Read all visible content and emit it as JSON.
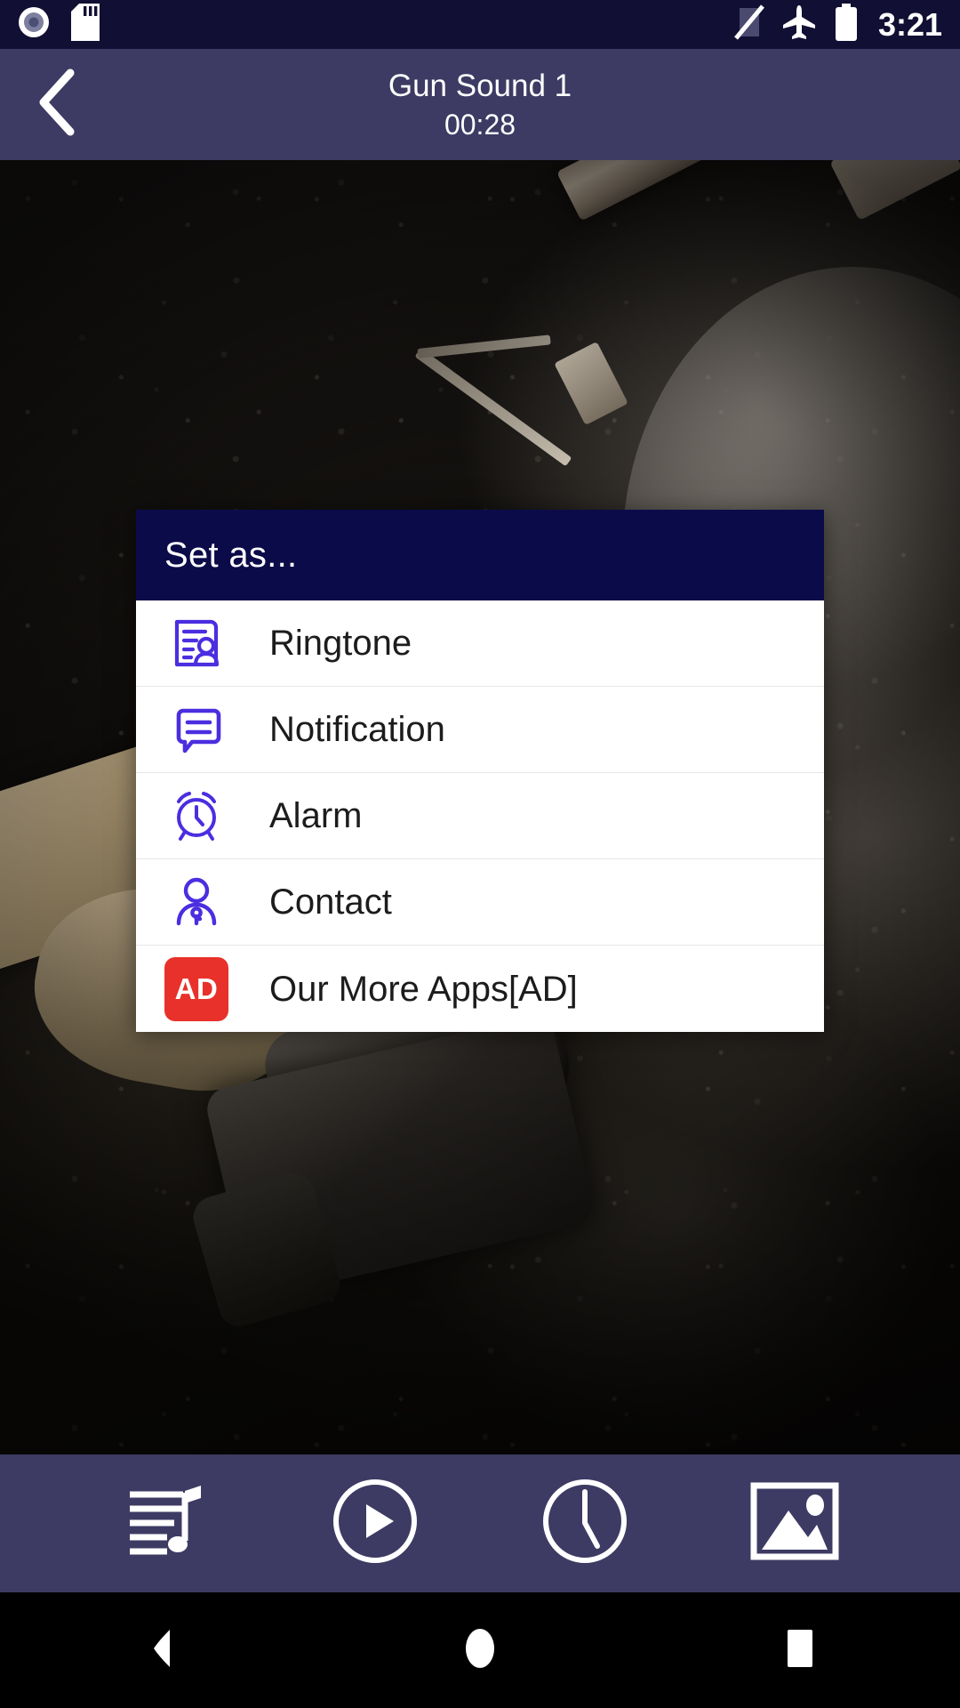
{
  "status_bar": {
    "time": "3:21",
    "left_icons": [
      {
        "name": "screen-recorder-icon"
      },
      {
        "name": "sd-card-icon"
      }
    ],
    "right_icons": [
      {
        "name": "signal-off-icon"
      },
      {
        "name": "airplane-mode-icon"
      },
      {
        "name": "battery-full-icon"
      }
    ],
    "background_color": "#110f33"
  },
  "app_bar": {
    "back_icon": "chevron-left-icon",
    "title": "Gun Sound 1",
    "subtitle": "00:28",
    "background_color": "#3d3b63"
  },
  "dialog": {
    "title": "Set as...",
    "header_color": "#0b0b49",
    "body_color": "#ffffff",
    "icon_color": "#4B2EE0",
    "items": [
      {
        "icon": "ringtone-contact-card-icon",
        "label": "Ringtone"
      },
      {
        "icon": "notification-speech-bubble-icon",
        "label": "Notification"
      },
      {
        "icon": "alarm-clock-icon",
        "label": "Alarm"
      },
      {
        "icon": "contact-person-icon",
        "label": "Contact"
      },
      {
        "icon": "ad-badge-icon",
        "label": "Our More Apps[AD]",
        "badge_text": "AD",
        "badge_color": "#e8312a"
      }
    ]
  },
  "bottom_bar": {
    "background_color": "#3d3b63",
    "buttons": [
      {
        "icon": "playlist-music-icon",
        "label": "Playlist"
      },
      {
        "icon": "play-circle-icon",
        "label": "Play"
      },
      {
        "icon": "clock-icon",
        "label": "Timer"
      },
      {
        "icon": "image-gallery-icon",
        "label": "Wallpaper"
      }
    ]
  },
  "nav_bar": {
    "background_color": "#000000",
    "buttons": [
      {
        "icon": "android-back-icon",
        "label": "Back"
      },
      {
        "icon": "android-home-icon",
        "label": "Home"
      },
      {
        "icon": "android-recents-icon",
        "label": "Recents"
      }
    ]
  }
}
